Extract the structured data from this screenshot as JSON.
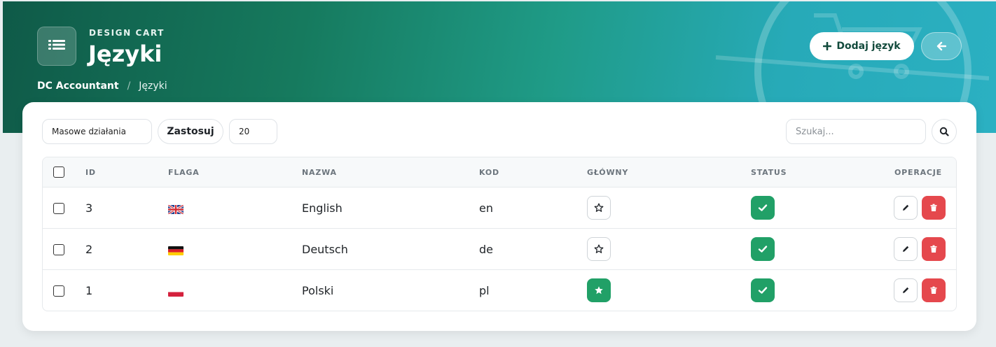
{
  "header": {
    "subtitle": "DESIGN CART",
    "title": "Języki",
    "add_button_label": "Dodaj język",
    "accent_color": "#167a5e"
  },
  "breadcrumb": {
    "root": "DC Accountant",
    "separator": "/",
    "current": "Języki"
  },
  "toolbar": {
    "bulk_actions": "Masowe działania",
    "apply_label": "Zastosuj",
    "per_page": "20",
    "search_placeholder": "Szukaj..."
  },
  "table": {
    "columns": [
      "ID",
      "FLAGA",
      "NAZWA",
      "KOD",
      "GŁÓWNY",
      "STATUS",
      "OPERACJE"
    ],
    "rows": [
      {
        "id": "3",
        "flag": "uk-flag-icon",
        "name": "English",
        "code": "en",
        "main": false,
        "status": true
      },
      {
        "id": "2",
        "flag": "de-flag-icon",
        "name": "Deutsch",
        "code": "de",
        "main": false,
        "status": true
      },
      {
        "id": "1",
        "flag": "pl-flag-icon",
        "name": "Polski",
        "code": "pl",
        "main": true,
        "status": true
      }
    ]
  },
  "colors": {
    "success": "#21a067",
    "danger": "#e5484d"
  }
}
